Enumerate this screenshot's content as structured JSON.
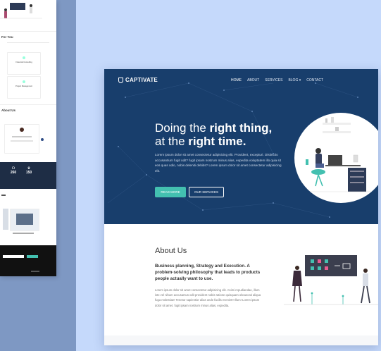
{
  "colors": {
    "hero_bg": "#183e6c",
    "accent": "#43c0b0",
    "page_bg": "#c5d9fb",
    "side_bg": "#7e98c3"
  },
  "mini": {
    "services_title": "For You",
    "card1_title": "Financial Consulting",
    "card2_title": "Project Management",
    "about_title": "About Us",
    "stat1_value": "260",
    "stat2_value": "150"
  },
  "site": {
    "logo": "CAPTIVATE",
    "nav": [
      {
        "label": "HOME"
      },
      {
        "label": "ABOUT"
      },
      {
        "label": "SERVICES"
      },
      {
        "label": "BLOG ▾"
      },
      {
        "label": "CONTACT"
      }
    ],
    "hero": {
      "line1_thin": "Doing the ",
      "line1_bold": "right thing,",
      "line2_thin": "at the ",
      "line2_bold": "right time.",
      "paragraph": "Lorem ipsum dolor sit amet consectetur adipisicing elit. Provident, excepturi. Distinctio accusantium fugit odit? fugit ipsam nostrum minus alias, expedita voluptatem illo quia sit eos quas odio, nobis deleniti debitis? Lorem ipsum dolor sit amet consectetur adipisicing elit.",
      "read_more": "READ MORE",
      "our_services": "OUR SERVICES"
    },
    "about": {
      "heading": "About Us",
      "subheading": "Business planning, Strategy and Execution. A problem-solving philosophy that leads to products people actually want to use.",
      "paragraph": "Lorem ipsum dolor sit amet consectetur adipisicing elit. Animi repudiandae, illum iste vel nihum accusamus odit provident nobis ratione quisquam obcaecati aliqua fuga molestiae! Tenetur sapientior alias unde facilis eveniet!! Illum! Lorem ipsum dolor sit amet. fugit ipsam nostrum minus alias, expedita."
    }
  }
}
